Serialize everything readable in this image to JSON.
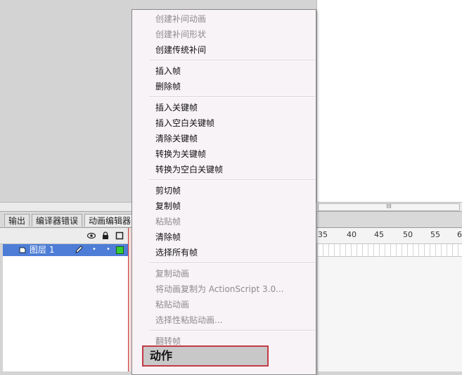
{
  "context_menu": {
    "groups": [
      [
        {
          "label": "创建补间动画",
          "enabled": false
        },
        {
          "label": "创建补间形状",
          "enabled": false
        },
        {
          "label": "创建传统补间",
          "enabled": true
        }
      ],
      [
        {
          "label": "插入帧",
          "enabled": true
        },
        {
          "label": "删除帧",
          "enabled": true
        }
      ],
      [
        {
          "label": "插入关键帧",
          "enabled": true
        },
        {
          "label": "插入空白关键帧",
          "enabled": true
        },
        {
          "label": "清除关键帧",
          "enabled": true
        },
        {
          "label": "转换为关键帧",
          "enabled": true
        },
        {
          "label": "转换为空白关键帧",
          "enabled": true
        }
      ],
      [
        {
          "label": "剪切帧",
          "enabled": true
        },
        {
          "label": "复制帧",
          "enabled": true
        },
        {
          "label": "粘贴帧",
          "enabled": false
        },
        {
          "label": "清除帧",
          "enabled": true
        },
        {
          "label": "选择所有帧",
          "enabled": true
        }
      ],
      [
        {
          "label": "复制动画",
          "enabled": false
        },
        {
          "label": "将动画复制为 ActionScript 3.0...",
          "enabled": false
        },
        {
          "label": "粘贴动画",
          "enabled": false
        },
        {
          "label": "选择性粘贴动画...",
          "enabled": false
        }
      ],
      [
        {
          "label": "翻转帧",
          "enabled": false
        }
      ]
    ],
    "highlighted_item": "动作"
  },
  "panel_tabs": [
    "输出",
    "编译器错误",
    "动画编辑器"
  ],
  "timeline": {
    "layer_name": "图层 1",
    "ruler_numbers": [
      "35",
      "40",
      "45",
      "50",
      "55",
      "6"
    ],
    "header_icons": [
      "eye-icon",
      "lock-icon",
      "outline-icon"
    ]
  },
  "scrollbar": {
    "thumb_glyph": "III"
  },
  "colors": {
    "menu_bg": "#f8f3f7",
    "layer_selected": "#4d7dd6",
    "layer_outline": "#33cc33",
    "callout_border": "#c23a45"
  }
}
